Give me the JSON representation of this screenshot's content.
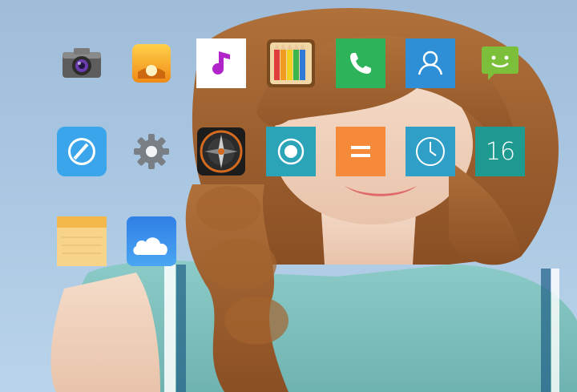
{
  "screen": {
    "type": "launcher-home",
    "wallpaper": "illustrated-girl-portrait"
  },
  "apps": [
    {
      "id": "camera",
      "icon": "camera-icon",
      "color": "#6b6b6b"
    },
    {
      "id": "gallery",
      "icon": "sunset-gallery-icon",
      "color": "#f5a623"
    },
    {
      "id": "music",
      "icon": "music-note-icon",
      "color": "#ffffff"
    },
    {
      "id": "notes-pencils",
      "icon": "colored-pencils-icon",
      "color": "#8b5a2b"
    },
    {
      "id": "phone",
      "icon": "phone-handset-icon",
      "color": "#2db45a"
    },
    {
      "id": "contacts",
      "icon": "contact-person-icon",
      "color": "#2f8fd6"
    },
    {
      "id": "messages",
      "icon": "smiley-chat-icon",
      "color": "#7bbf3a"
    },
    {
      "id": "browser",
      "icon": "compass-browser-icon",
      "color": "#3aa5ea"
    },
    {
      "id": "settings",
      "icon": "gear-icon",
      "color": "#7a7f86"
    },
    {
      "id": "compass",
      "icon": "compass-dial-icon",
      "color": "#d46a1f"
    },
    {
      "id": "recorder",
      "icon": "record-circle-icon",
      "color": "#2ba4b8"
    },
    {
      "id": "calculator",
      "icon": "equals-calculator-icon",
      "color": "#f58a3a"
    },
    {
      "id": "clock",
      "icon": "clock-icon",
      "color": "#2f9fc7"
    },
    {
      "id": "calendar",
      "icon": "calendar-date-icon",
      "color": "#1f9a91",
      "value": "16"
    },
    {
      "id": "notes",
      "icon": "notepad-icon",
      "color": "#f5c96a"
    },
    {
      "id": "cloud",
      "icon": "cloud-icon",
      "color": "#2f8be6"
    }
  ]
}
